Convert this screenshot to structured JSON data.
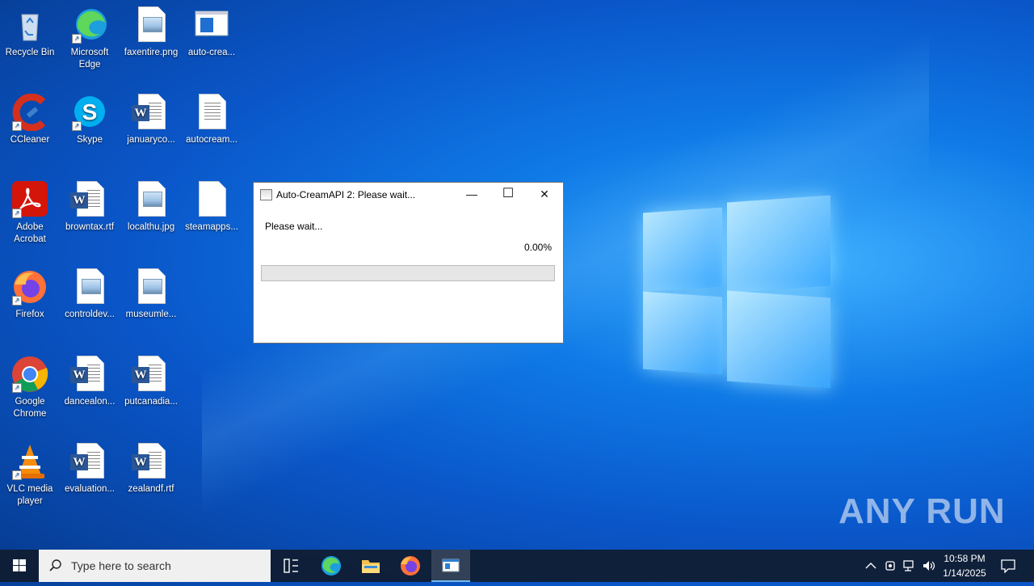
{
  "desktop": {
    "icons": [
      {
        "label": "Recycle Bin",
        "icon": "recycle-bin-icon"
      },
      {
        "label": "Microsoft Edge",
        "icon": "edge-icon"
      },
      {
        "label": "faxentire.png",
        "icon": "image-file-icon"
      },
      {
        "label": "auto-crea...",
        "icon": "app-window-icon"
      },
      {
        "label": "CCleaner",
        "icon": "ccleaner-icon"
      },
      {
        "label": "Skype",
        "icon": "skype-icon"
      },
      {
        "label": "januaryco...",
        "icon": "word-doc-icon"
      },
      {
        "label": "autocream...",
        "icon": "text-file-icon"
      },
      {
        "label": "Adobe Acrobat",
        "icon": "acrobat-icon"
      },
      {
        "label": "browntax.rtf",
        "icon": "word-doc-icon"
      },
      {
        "label": "localthu.jpg",
        "icon": "image-file-icon"
      },
      {
        "label": "steamapps...",
        "icon": "blank-file-icon"
      },
      {
        "label": "Firefox",
        "icon": "firefox-icon"
      },
      {
        "label": "controldev...",
        "icon": "image-file-icon"
      },
      {
        "label": "museumle...",
        "icon": "image-file-icon"
      },
      {
        "label": "Google Chrome",
        "icon": "chrome-icon"
      },
      {
        "label": "dancealon...",
        "icon": "word-doc-icon"
      },
      {
        "label": "putcanadia...",
        "icon": "word-doc-icon"
      },
      {
        "label": "VLC media player",
        "icon": "vlc-icon"
      },
      {
        "label": "evaluation...",
        "icon": "word-doc-icon"
      },
      {
        "label": "zealandf.rtf",
        "icon": "word-doc-icon"
      }
    ]
  },
  "dialog": {
    "title": "Auto-CreamAPI 2: Please wait...",
    "message": "Please wait...",
    "percent_text": "0.00%",
    "progress": 0,
    "minimize_glyph": "—",
    "maximize_glyph": "☐",
    "close_glyph": "✕"
  },
  "taskbar": {
    "search_placeholder": "Type here to search",
    "time": "10:58 PM",
    "date": "1/14/2025"
  },
  "watermark": "ANY RUN",
  "colors": {
    "taskbar_active_underline": "#76b9ed",
    "progress_track": "#e6e6e6"
  }
}
